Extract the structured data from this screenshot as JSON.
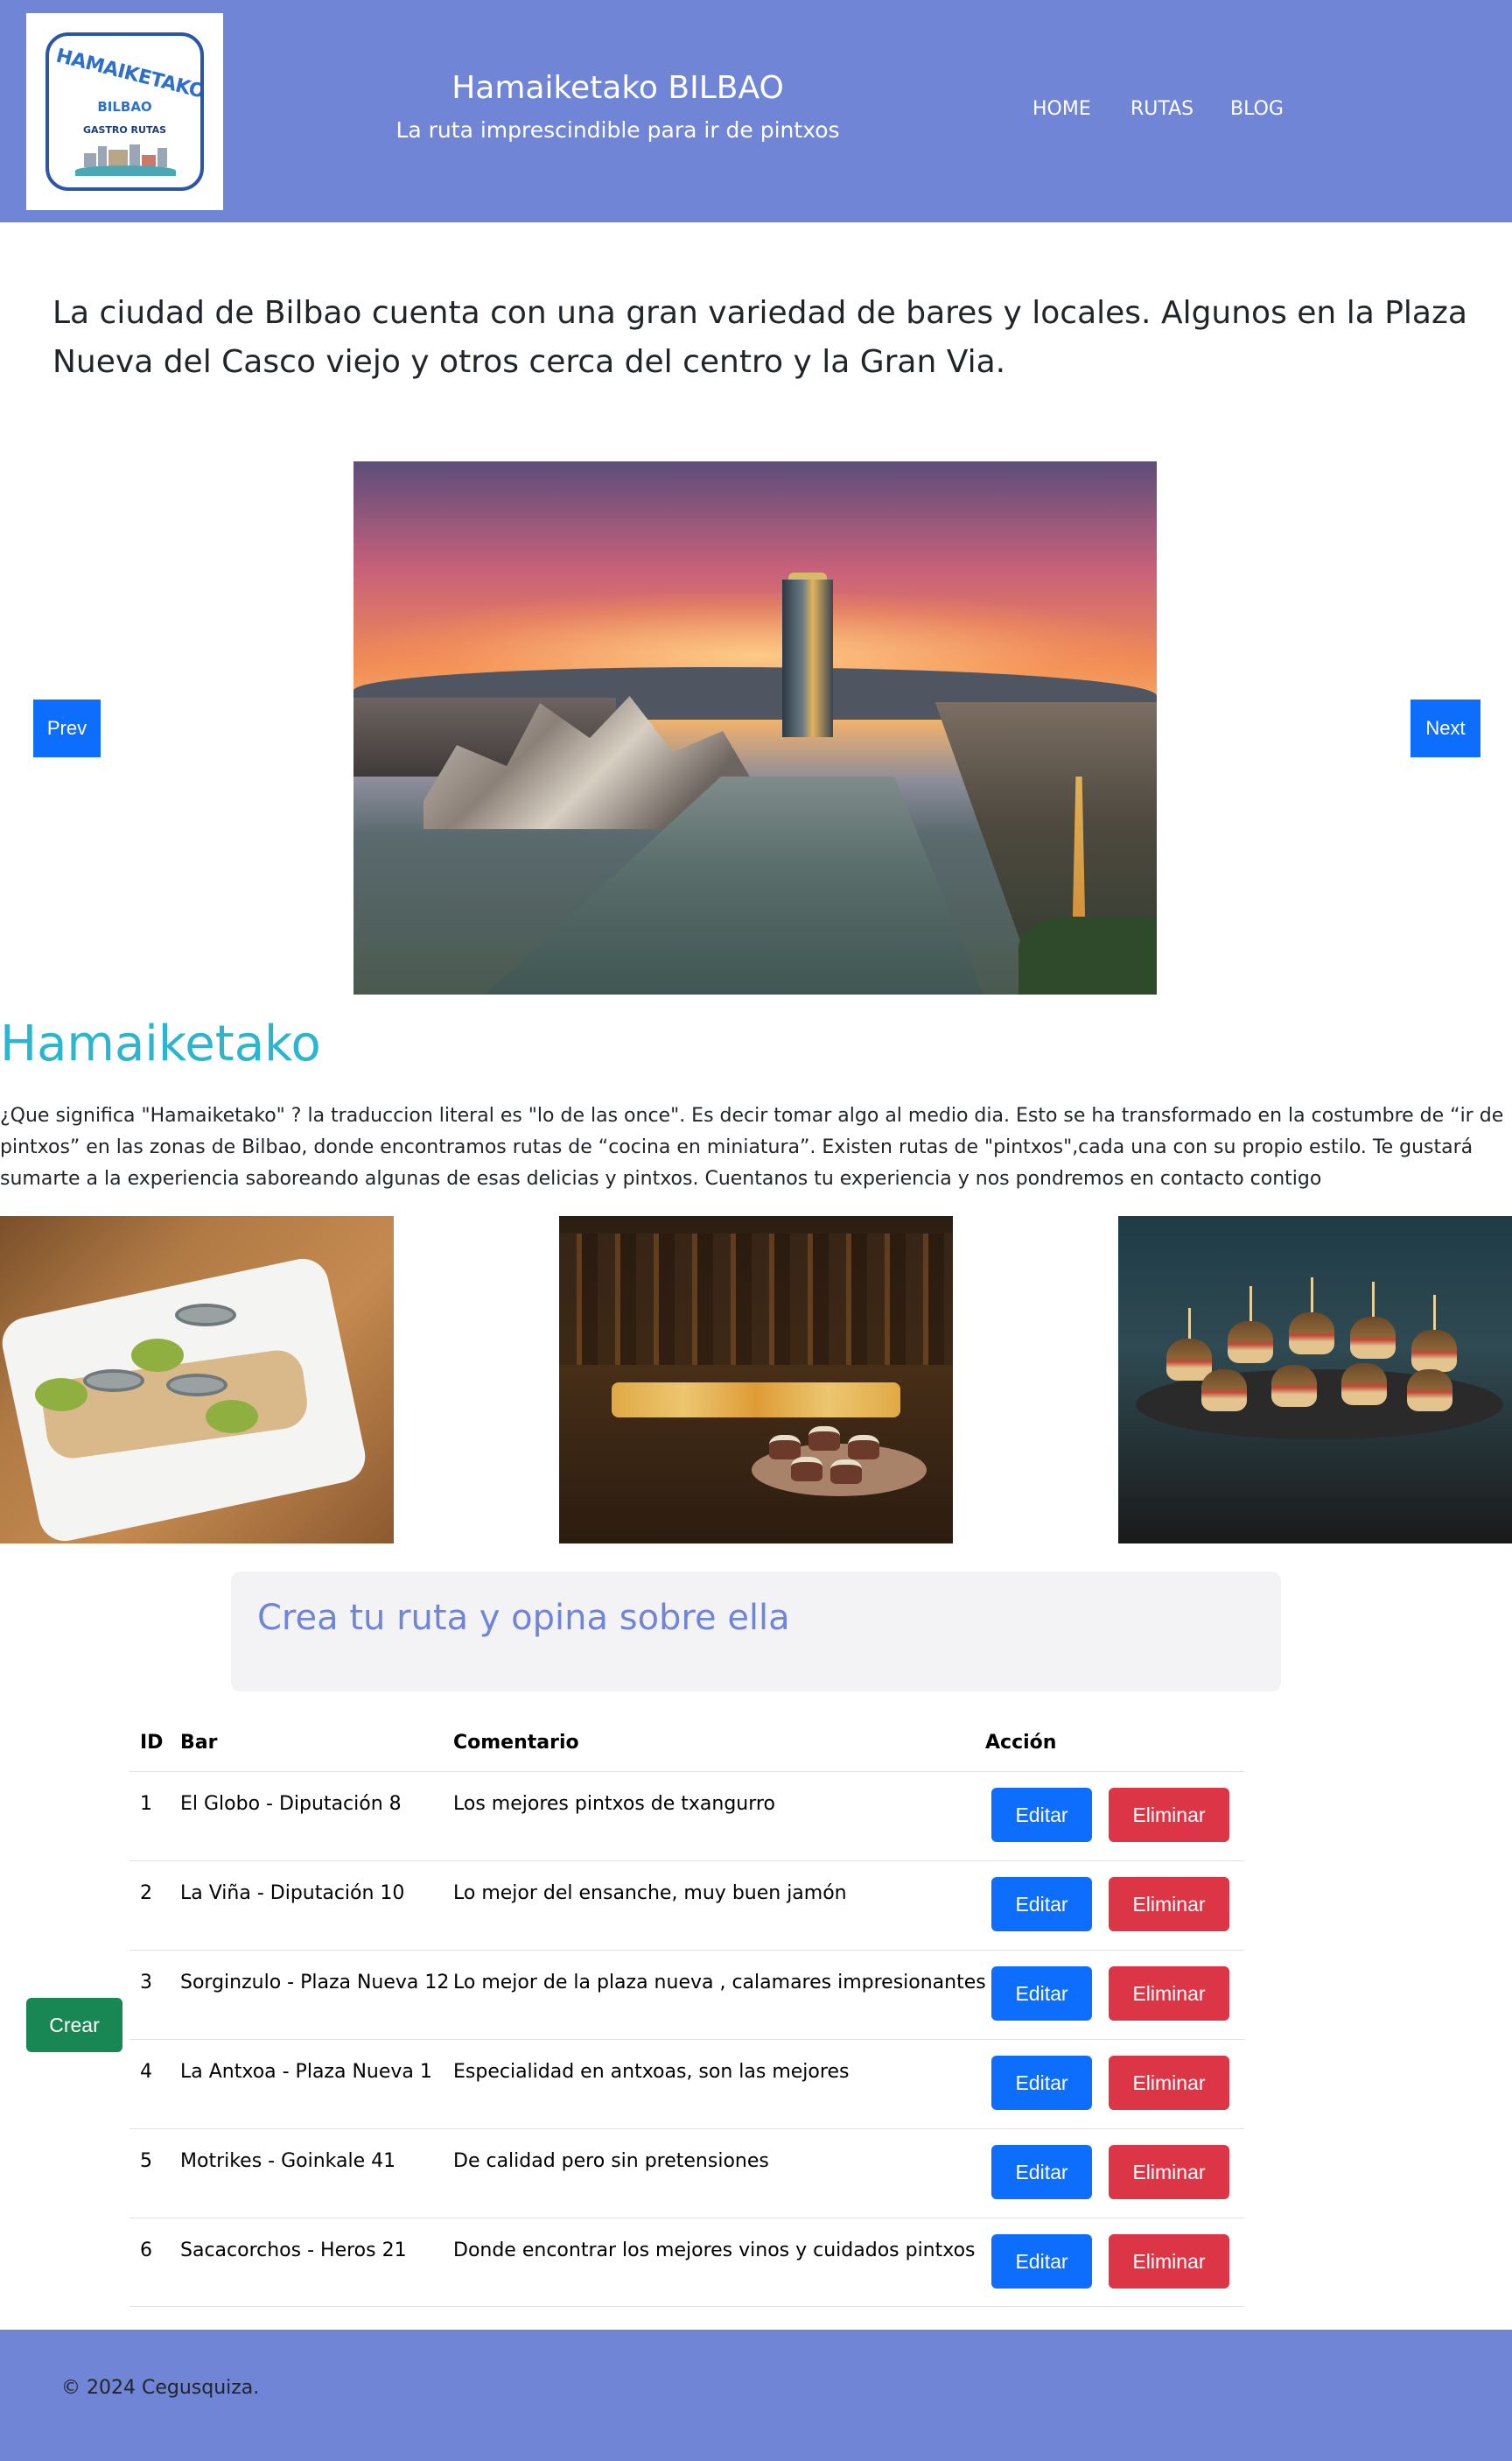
{
  "header": {
    "logo": {
      "title": "HAMAIKETAKO",
      "subtitle": "BILBAO",
      "tagline": "GASTRO RUTAS"
    },
    "title": "Hamaiketako BILBAO",
    "subtitle": "La ruta imprescindible para ir de pintxos",
    "nav": [
      "HOME",
      "RUTAS",
      "BLOG"
    ]
  },
  "intro": "La ciudad de Bilbao cuenta con una gran variedad de bares y locales. Algunos en la Plaza Nueva del Casco viejo y otros cerca del centro y la Gran Via.",
  "carousel": {
    "prev_label": "Prev",
    "next_label": "Next",
    "image": "bilbao-guggenheim-sunset-photo"
  },
  "section": {
    "title": "Hamaiketako",
    "text": "¿Que significa \"Hamaiketako\" ? la traduccion literal es \"lo de las once\". Es decir tomar algo al medio dia. Esto se ha transformado en la costumbre de “ir de pintxos” en las zonas de Bilbao, donde encontramos rutas de “cocina en miniatura”. Existen rutas de \"pintxos\",cada una con su propio estilo. Te gustará sumarte a la experiencia saboreando algunas de esas delicias y pintxos. Cuentanos tu experiencia y nos pondremos en contacto contigo",
    "photos": [
      "anchovy-pepper-pintxo-photo",
      "pintxo-bar-counter-photo",
      "mini-burger-pintxos-photo"
    ]
  },
  "form": {
    "title": "Crea tu ruta y opina sobre ella",
    "create_label": "Crear"
  },
  "table": {
    "headers": [
      "ID",
      "Bar",
      "Comentario",
      "Acción"
    ],
    "edit_label": "Editar",
    "delete_label": "Eliminar",
    "rows": [
      {
        "id": "1",
        "bar": "El Globo - Diputación 8",
        "comment": "Los mejores pintxos de txangurro"
      },
      {
        "id": "2",
        "bar": "La Viña - Diputación 10",
        "comment": "Lo mejor del ensanche, muy buen jamón"
      },
      {
        "id": "3",
        "bar": "Sorginzulo - Plaza Nueva 12",
        "comment": "Lo mejor de la plaza nueva , calamares impresionantes"
      },
      {
        "id": "4",
        "bar": "La Antxoa - Plaza Nueva 1",
        "comment": "Especialidad en antxoas, son las mejores"
      },
      {
        "id": "5",
        "bar": "Motrikes - Goinkale 41",
        "comment": "De calidad pero sin pretensiones"
      },
      {
        "id": "6",
        "bar": "Sacacorchos - Heros 21",
        "comment": "Donde encontrar los mejores vinos y cuidados pintxos"
      }
    ]
  },
  "footer": {
    "text": "© 2024 Cegusquiza."
  },
  "colors": {
    "header_bg": "#7185d6",
    "section_title": "#2bb5cf",
    "primary_button": "#0d6efd",
    "danger_button": "#dc3545",
    "success_button": "#198754"
  }
}
